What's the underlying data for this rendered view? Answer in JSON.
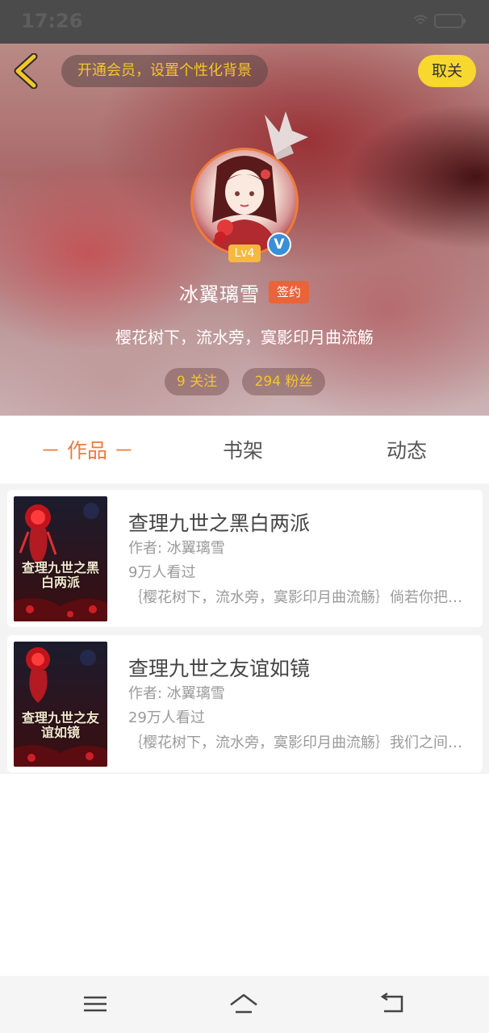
{
  "status_bar": {
    "time": "17:26"
  },
  "header": {
    "vip_banner": "开通会员，设置个性化背景",
    "unfollow_label": "取关"
  },
  "profile": {
    "level": "Lv4",
    "verified_mark": "V",
    "name": "冰翼璃雪",
    "signed_badge": "签约",
    "bio": "樱花树下，流水旁，寞影印月曲流觞",
    "following": "9 关注",
    "fans": "294 粉丝"
  },
  "tabs": [
    {
      "label": "－ 作品 －",
      "active": true
    },
    {
      "label": "书架",
      "active": false
    },
    {
      "label": "动态",
      "active": false
    }
  ],
  "books": [
    {
      "cover_title": "查理九世之黑白两派",
      "title": "查理九世之黑白两派",
      "author": "作者: 冰翼璃雪",
      "views": "9万人看过",
      "desc": "｛樱花树下，流水旁，寞影印月曲流觞｝倘若你把人生看作是一场游戏，那么这场游戏的规则由谁来定"
    },
    {
      "cover_title": "查理九世之友谊如镜",
      "title": "查理九世之友谊如镜",
      "author": "作者: 冰翼璃雪",
      "views": "29万人看过",
      "desc": "｛樱花树下，流水旁，寞影印月曲流觞｝我们之间的友谊就像一面镜子"
    }
  ],
  "colors": {
    "accent": "#ef7a3b",
    "vip_text": "#f5c52a",
    "unfollow_bg": "#f8d72e",
    "sign_badge": "#e8643a",
    "verified": "#3a8fd8"
  },
  "icons": [
    "back-arrow-icon",
    "crown-icon",
    "verified-icon",
    "menu-icon",
    "home-icon",
    "return-icon"
  ]
}
